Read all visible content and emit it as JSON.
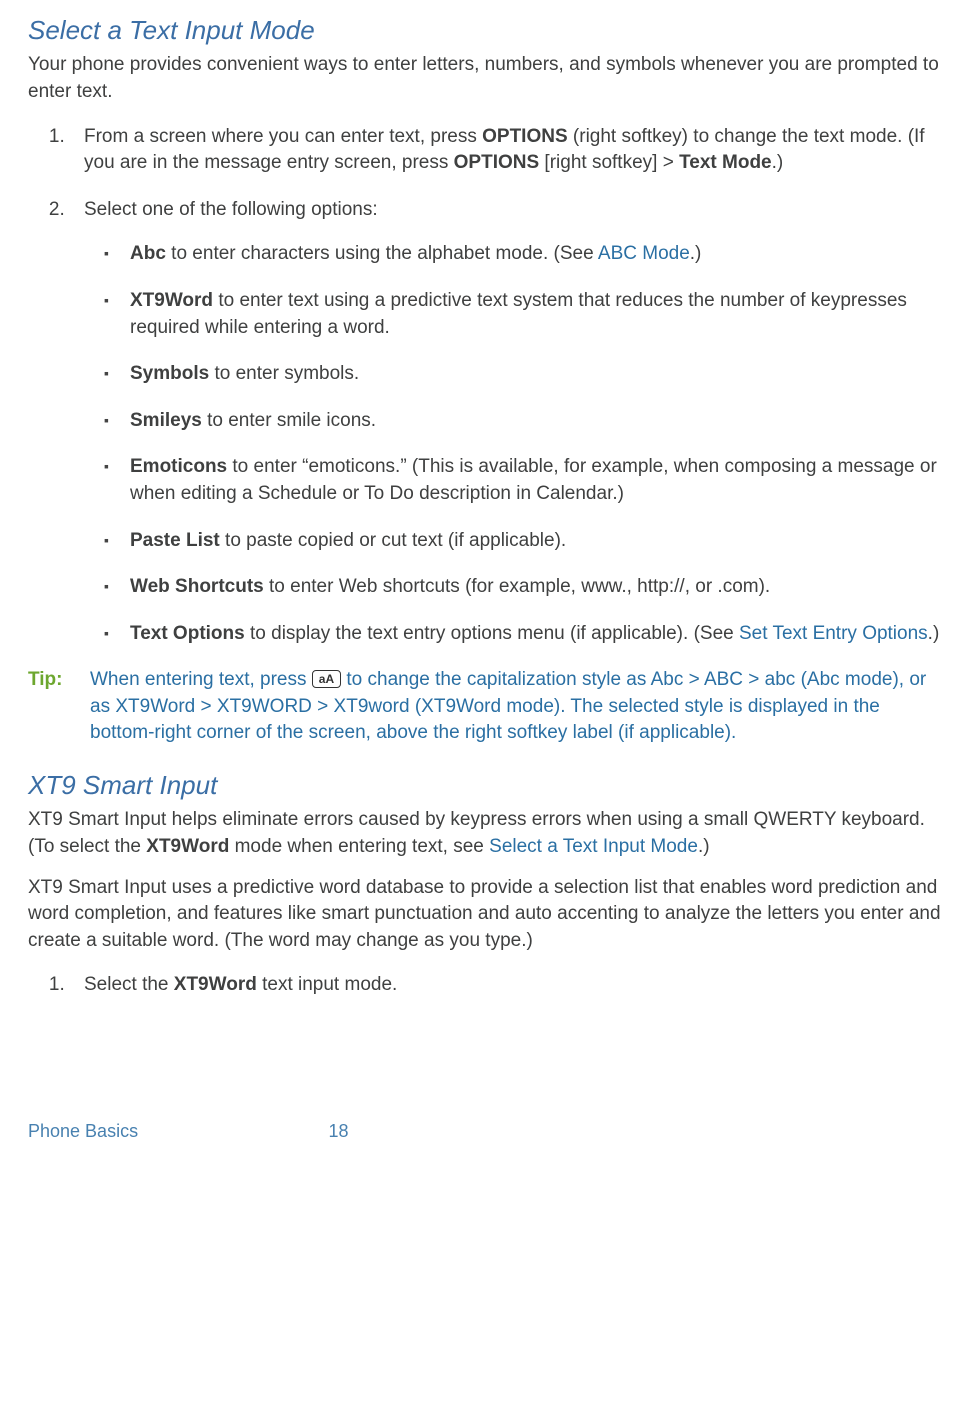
{
  "section1": {
    "heading": "Select a Text Input Mode",
    "intro": "Your phone provides convenient ways to enter letters, numbers, and symbols whenever you are prompted to enter text.",
    "step1_a": "From a screen where you can enter text, press ",
    "step1_opt": "OPTIONS",
    "step1_b": " (right softkey) to change the text mode. (If you are in the message entry screen, press ",
    "step1_opt2": "OPTIONS",
    "step1_c": " [right softkey] > ",
    "step1_tm": "Text Mode",
    "step1_d": ".)",
    "step2": "Select one of the following options:",
    "bullets": {
      "abc_bold": "Abc",
      "abc_rest": " to enter characters using the alphabet mode. (See ",
      "abc_link": "ABC Mode",
      "abc_after": ".)",
      "xt9_bold": "XT9Word",
      "xt9_rest": " to enter text using a predictive text system that reduces the number of keypresses required while entering a word.",
      "sym_bold": "Symbols",
      "sym_rest": " to enter symbols.",
      "smi_bold": "Smileys",
      "smi_rest": " to enter smile icons.",
      "emo_bold": "Emoticons",
      "emo_rest": " to enter “emoticons.” (This is available, for example, when composing a message or when editing a Schedule or To Do description in Calendar.)",
      "pas_bold": "Paste List",
      "pas_rest": " to paste copied or cut text (if applicable).",
      "web_bold": "Web Shortcuts",
      "web_rest": " to enter Web shortcuts (for example, www., http://, or .com).",
      "txt_bold": "Text Options",
      "txt_rest": " to display the text entry options menu (if applicable). (See ",
      "txt_link": "Set Text Entry Options",
      "txt_after": ".)"
    }
  },
  "tip": {
    "label": "Tip:",
    "key": "aA",
    "before": "When entering text, press ",
    "after": " to change the capitalization style as Abc > ABC > abc (Abc mode), or as XT9Word > XT9WORD > XT9word (XT9Word mode). The selected style is displayed in the bottom-right corner of the screen, above the right softkey label (if applicable)."
  },
  "section2": {
    "heading": "XT9 Smart Input",
    "p1_a": "XT9 Smart Input helps eliminate errors caused by keypress errors when using a small QWERTY keyboard. (To select the ",
    "p1_bold": "XT9Word",
    "p1_b": " mode when entering text, see ",
    "p1_link": "Select a Text Input Mode",
    "p1_c": ".)",
    "p2": "XT9 Smart Input uses a predictive word database to provide a selection list that enables word prediction and word completion, and features like smart punctuation and auto accenting to analyze the letters you enter and create a suitable word. (The word may change as you type.)",
    "step1_a": "Select the ",
    "step1_bold": "XT9Word",
    "step1_b": " text input mode."
  },
  "footer": {
    "left": "Phone Basics",
    "page": "18"
  }
}
